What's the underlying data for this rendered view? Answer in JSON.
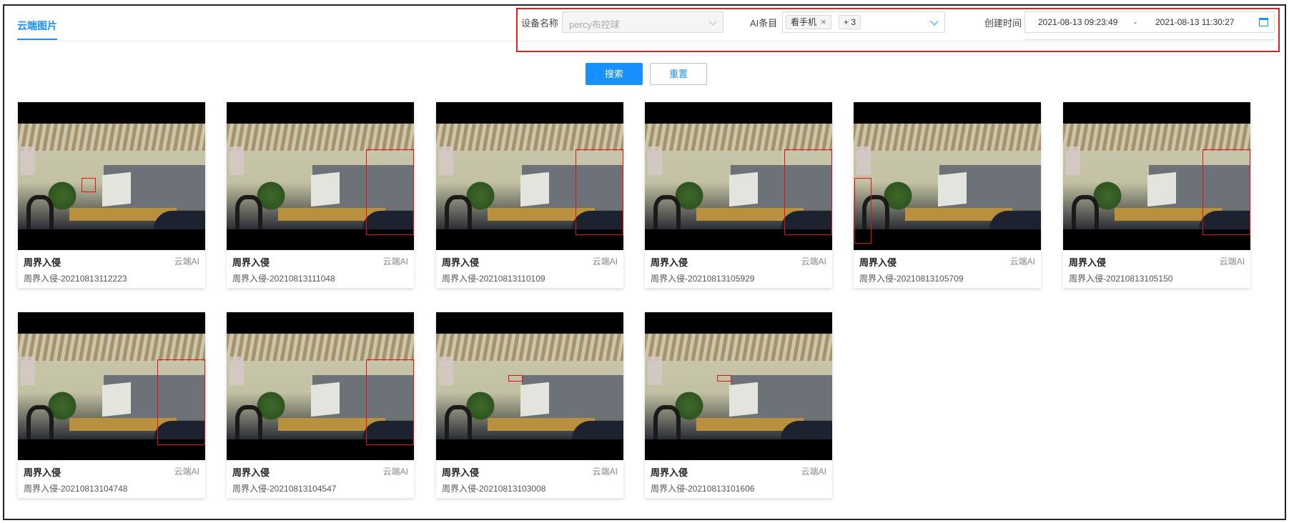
{
  "tabs": [
    {
      "label": "云端图片",
      "active": true
    }
  ],
  "filters": {
    "device_label": "设备名称",
    "device_value": "percy布控球",
    "ai_label": "AI条目",
    "ai_tags": [
      "看手机"
    ],
    "ai_more": "+ 3",
    "time_label": "创建时间",
    "time_start": "2021-08-13 09:23:49",
    "time_sep": "-",
    "time_end": "2021-08-13 11:30:27"
  },
  "buttons": {
    "search": "搜索",
    "reset": "重置"
  },
  "colors": {
    "accent": "#1890ff",
    "detection_box": "#e31010"
  },
  "cards": [
    {
      "title": "周界入侵",
      "source": "云端AI",
      "subtitle": "周界入侵-20210813112223",
      "detection": "head"
    },
    {
      "title": "周界入侵",
      "source": "云端AI",
      "subtitle": "周界入侵-20210813111048",
      "detection": "right-region"
    },
    {
      "title": "周界入侵",
      "source": "云端AI",
      "subtitle": "周界入侵-20210813110109",
      "detection": "right-region"
    },
    {
      "title": "周界入侵",
      "source": "云端AI",
      "subtitle": "周界入侵-20210813105929",
      "detection": "right-region"
    },
    {
      "title": "周界入侵",
      "source": "云端AI",
      "subtitle": "周界入侵-20210813105709",
      "detection": "person-left"
    },
    {
      "title": "周界入侵",
      "source": "云端AI",
      "subtitle": "周界入侵-20210813105150",
      "detection": "right-region"
    },
    {
      "title": "周界入侵",
      "source": "云端AI",
      "subtitle": "周界入侵-20210813104748",
      "detection": "right-region"
    },
    {
      "title": "周界入侵",
      "source": "云端AI",
      "subtitle": "周界入侵-20210813104547",
      "detection": "right-region"
    },
    {
      "title": "周界入侵",
      "source": "云端AI",
      "subtitle": "周界入侵-20210813103008",
      "detection": "small-center"
    },
    {
      "title": "周界入侵",
      "source": "云端AI",
      "subtitle": "周界入侵-20210813101606",
      "detection": "small-center"
    }
  ]
}
